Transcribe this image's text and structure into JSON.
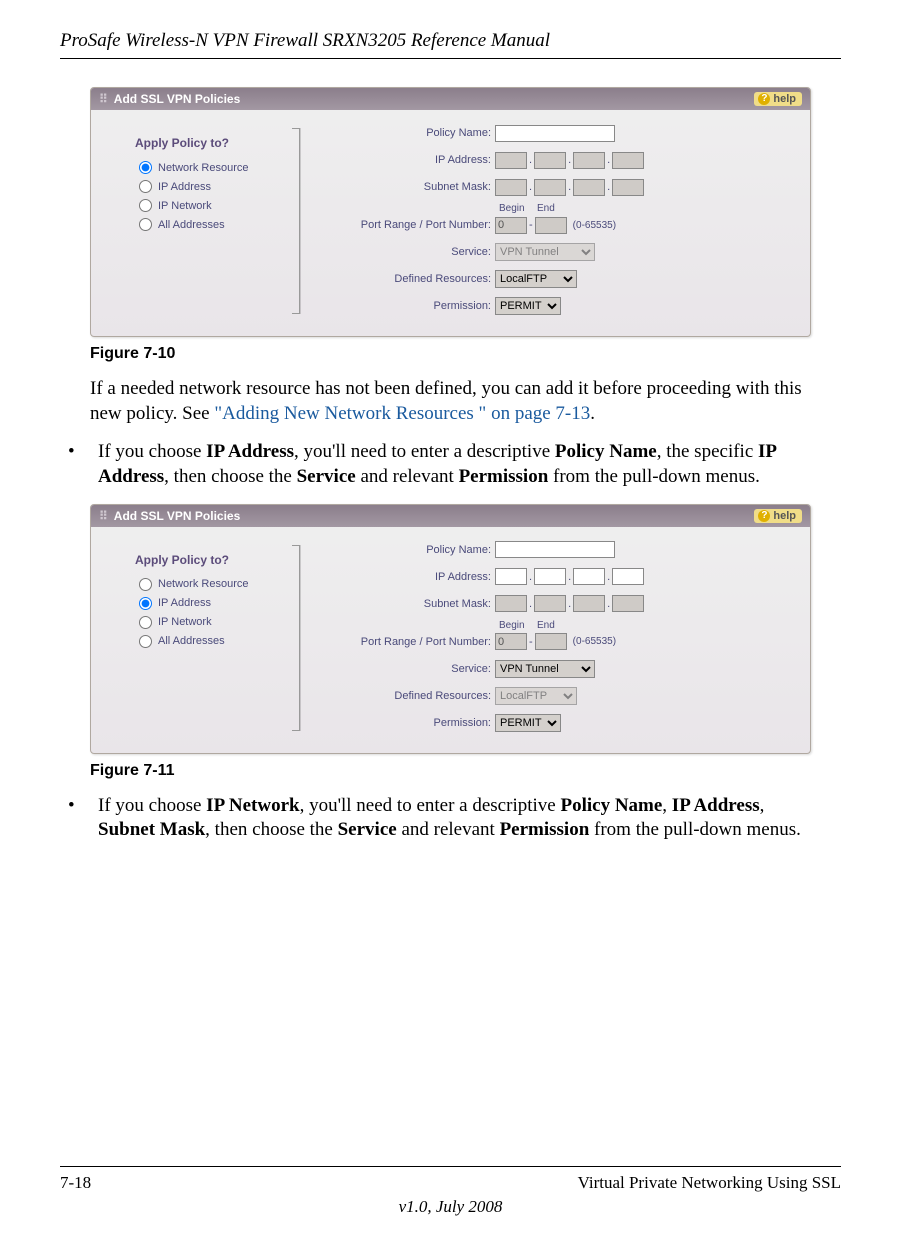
{
  "header": {
    "title": "ProSafe Wireless-N VPN Firewall SRXN3205 Reference Manual"
  },
  "figure1": {
    "caption": "Figure 7-10",
    "panel_title": "Add SSL VPN Policies",
    "help_label": "help",
    "apply_title": "Apply Policy to?",
    "radios": {
      "r0": "Network Resource",
      "r1": "IP Address",
      "r2": "IP Network",
      "r3": "All Addresses"
    },
    "labels": {
      "policy_name": "Policy Name:",
      "ip_address": "IP Address:",
      "subnet_mask": "Subnet Mask:",
      "port_range": "Port Range / Port Number:",
      "begin": "Begin",
      "end": "End",
      "port_note": "(0-65535)",
      "service": "Service:",
      "defined_resources": "Defined Resources:",
      "permission": "Permission:"
    },
    "values": {
      "port_begin": "0",
      "service": "VPN Tunnel",
      "defined_resources": "LocalFTP",
      "permission": "PERMIT"
    }
  },
  "para1": {
    "lead": "If a needed network resource has not been defined, you can add it before proceeding with this new policy. See ",
    "link": "\"Adding New Network Resources \" on page 7-13",
    "end": "."
  },
  "bullet1": {
    "pre": "If you choose ",
    "b1": "IP Address",
    "m1": ", you'll need to enter a descriptive ",
    "b2": "Policy Name",
    "m2": ", the specific ",
    "b3": "IP Address",
    "m3": ", then choose the ",
    "b4": "Service",
    "m4": " and relevant ",
    "b5": "Permission",
    "m5": " from the pull-down menus."
  },
  "figure2": {
    "caption": "Figure 7-11",
    "panel_title": "Add SSL VPN Policies",
    "help_label": "help",
    "apply_title": "Apply Policy to?",
    "radios": {
      "r0": "Network Resource",
      "r1": "IP Address",
      "r2": "IP Network",
      "r3": "All Addresses"
    },
    "labels": {
      "policy_name": "Policy Name:",
      "ip_address": "IP Address:",
      "subnet_mask": "Subnet Mask:",
      "port_range": "Port Range / Port Number:",
      "begin": "Begin",
      "end": "End",
      "port_note": "(0-65535)",
      "service": "Service:",
      "defined_resources": "Defined Resources:",
      "permission": "Permission:"
    },
    "values": {
      "port_begin": "0",
      "service": "VPN Tunnel",
      "defined_resources": "LocalFTP",
      "permission": "PERMIT"
    }
  },
  "bullet2": {
    "pre": "If you choose ",
    "b1": "IP Network",
    "m1": ", you'll need to enter a descriptive ",
    "b2": "Policy Name",
    "m2": ", ",
    "b3": "IP Address",
    "m3": ", ",
    "b4": "Subnet Mask",
    "m4": ", then choose the ",
    "b5": "Service",
    "m5": " and relevant ",
    "b6": "Permission",
    "m6": " from the pull-down menus."
  },
  "footer": {
    "page": "7-18",
    "section": "Virtual Private Networking Using SSL",
    "version": "v1.0, July 2008"
  }
}
